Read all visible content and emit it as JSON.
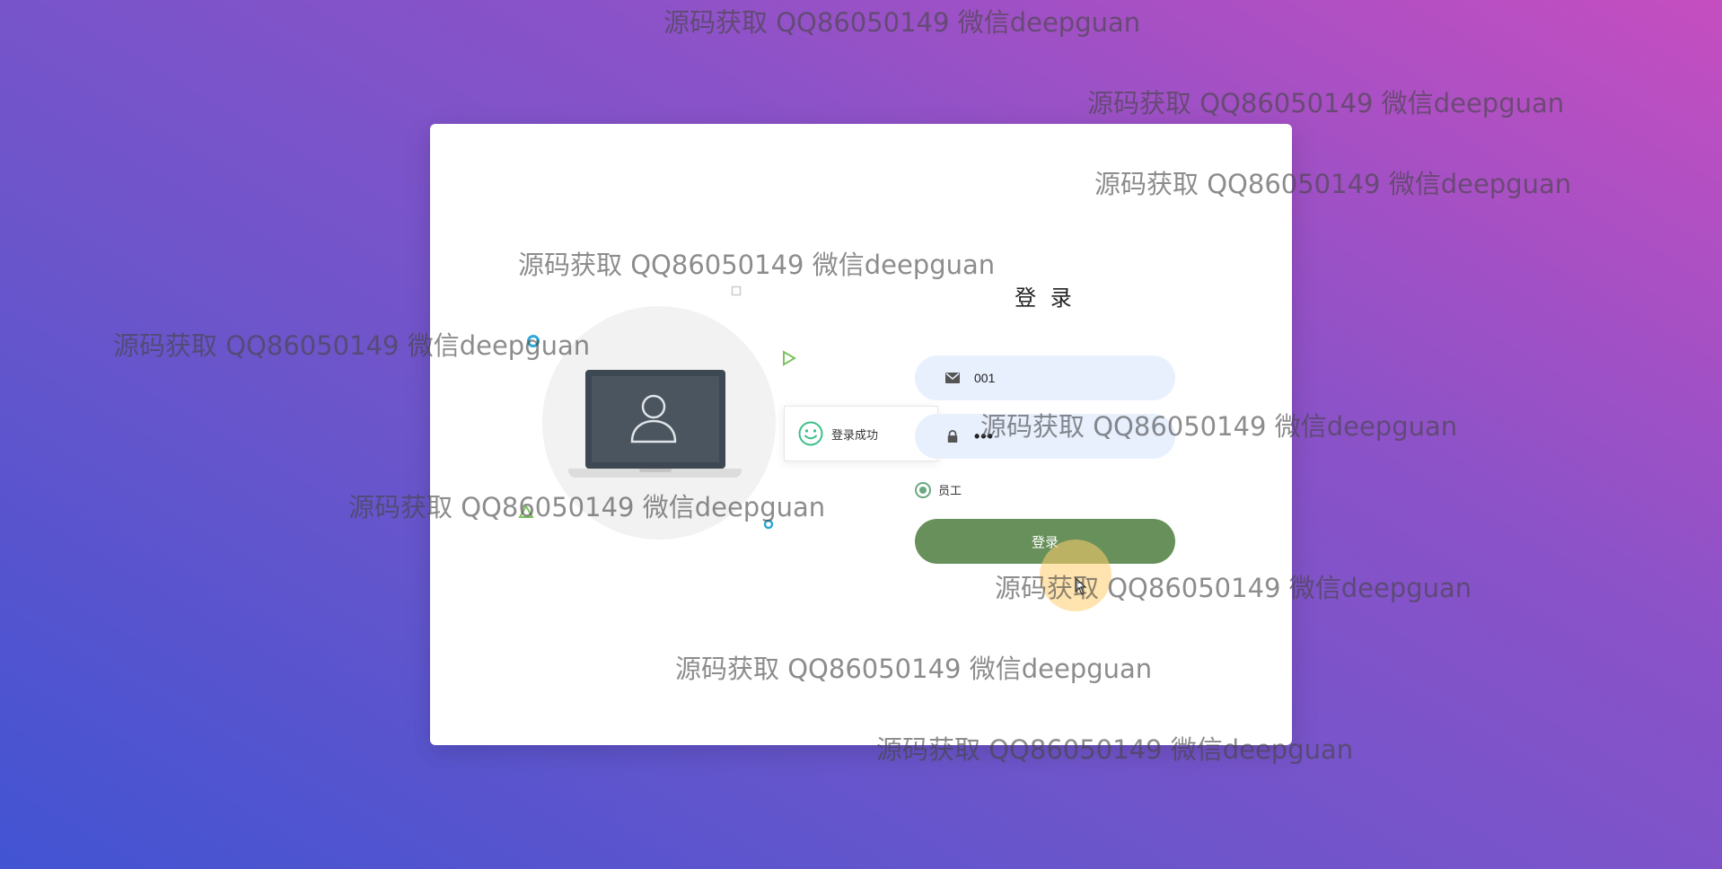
{
  "login": {
    "title": "登 录",
    "username_value": "001",
    "password_value": "•••",
    "role_option": "员工",
    "button_label": "登录"
  },
  "toast": {
    "message": "登录成功"
  },
  "watermarks": [
    "源码获取 QQ86050149 微信deepguan",
    "源码获取 QQ86050149 微信deepguan",
    "源码获取 QQ86050149 微信deepguan",
    "源码获取 QQ86050149 微信deepguan",
    "源码获取 QQ86050149 微信deepguan",
    "源码获取 QQ86050149 微信deepguan",
    "源码获取 QQ86050149 微信deepguan",
    "源码获取 QQ86050149 微信deepguan",
    "源码获取 QQ86050149 微信deepguan",
    "源码获取 QQ86050149 微信deepguan"
  ],
  "icons": {
    "username": "envelope-icon",
    "password": "lock-icon",
    "toast": "smile-icon",
    "illustration_user": "user-icon"
  },
  "colors": {
    "button": "#68905a",
    "input_background": "#e8f0fe",
    "radio": "#6aa882",
    "toast_icon": "#3cbf88"
  }
}
